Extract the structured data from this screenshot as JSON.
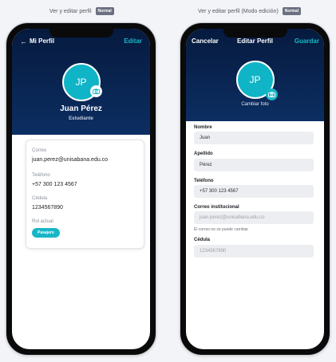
{
  "captions": {
    "left": {
      "text": "Ver y editar perfil",
      "badge": "Normal"
    },
    "right": {
      "text": "Ver y editar perfil (Modo edición)",
      "badge": "Normal"
    }
  },
  "view": {
    "title": "Mi Perfil",
    "edit_label": "Editar",
    "initials": "JP",
    "name": "Juan Pérez",
    "role": "Estudiante",
    "fields": [
      {
        "label": "Correo",
        "value": "juan.perez@unisabana.edu.co"
      },
      {
        "label": "Teléfono",
        "value": "+57 300 123 4567"
      },
      {
        "label": "Cédula",
        "value": "1234567890"
      }
    ],
    "role_field": {
      "label": "Rol actual",
      "value": "Pasajero"
    }
  },
  "edit": {
    "cancel_label": "Cancelar",
    "title": "Editar Perfil",
    "save_label": "Guardar",
    "initials": "JP",
    "change_photo_label": "Cambiar foto",
    "fields": [
      {
        "label": "Nombre",
        "value": "Juan"
      },
      {
        "label": "Apellido",
        "value": "Pérez"
      },
      {
        "label": "Teléfono",
        "value": "+57 300 123 4567"
      },
      {
        "label": "Correo institucional",
        "value": "juan.perez@unisabana.edu.co"
      },
      {
        "label": "Cédula",
        "value": "1234567890"
      }
    ],
    "email_note": "El correo no se puede cambiar"
  },
  "colors": {
    "header": "#0c2e62",
    "accent": "#17b6c6",
    "avatar": "#0fb4c6"
  },
  "icons": [
    "back-arrow-icon",
    "camera-icon"
  ]
}
